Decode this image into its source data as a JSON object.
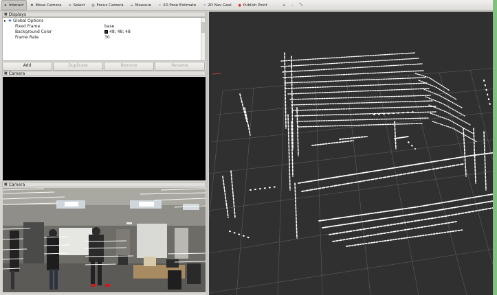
{
  "toolbar": {
    "tools": [
      {
        "label": "Interact",
        "icon": "interact-icon",
        "active": true
      },
      {
        "label": "Move Camera",
        "icon": "move-camera-icon"
      },
      {
        "label": "Select",
        "icon": "select-icon"
      },
      {
        "label": "Focus Camera",
        "icon": "focus-camera-icon"
      },
      {
        "label": "Measure",
        "icon": "measure-icon"
      },
      {
        "label": "2D Pose Estimate",
        "icon": "pose-estimate-icon"
      },
      {
        "label": "2D Nav Goal",
        "icon": "nav-goal-icon"
      },
      {
        "label": "Publish Point",
        "icon": "publish-point-icon"
      }
    ],
    "extra_icons": [
      "plus-icon",
      "minus-icon",
      "arrows-icon"
    ]
  },
  "displays": {
    "title": "Displays",
    "group_label": "Global Options",
    "props": [
      {
        "key": "Fixed Frame",
        "value": "base"
      },
      {
        "key": "Background Color",
        "value": "48; 48; 48",
        "swatch": "#303030"
      },
      {
        "key": "Frame Rate",
        "value": "30"
      }
    ],
    "buttons": {
      "add": "Add",
      "duplicate": "Duplicate",
      "remove": "Remove",
      "rename": "Rename"
    }
  },
  "camera_panels": [
    {
      "title": "Camera"
    },
    {
      "title": "Camera"
    }
  ],
  "colors": {
    "view_background": "#303030",
    "grid": "#5a5a5a",
    "points": "#ffffff"
  }
}
